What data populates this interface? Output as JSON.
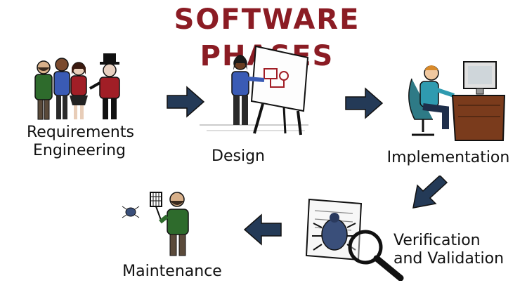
{
  "title": "SOFTWARE PHASES",
  "phases": [
    {
      "label_lines": [
        "Requirements",
        "Engineering"
      ],
      "icon": "people-group-icon"
    },
    {
      "label_lines": [
        "Design"
      ],
      "icon": "easel-designer-icon"
    },
    {
      "label_lines": [
        "Implementation"
      ],
      "icon": "programmer-at-desk-icon"
    },
    {
      "label_lines": [
        "Verification",
        "and Validation"
      ],
      "icon": "magnifier-bug-document-icon"
    },
    {
      "label_lines": [
        "Maintenance"
      ],
      "icon": "bug-swatter-person-icon"
    }
  ],
  "arrows": [
    "arrow-right-icon",
    "arrow-right-icon",
    "arrow-down-left-icon",
    "arrow-left-icon"
  ],
  "colors": {
    "title": "#8b1c24",
    "arrow": "#243a57",
    "ink": "#111111",
    "green_shirt": "#2e6b2c",
    "blue_shirt": "#3a5bb5",
    "red_shirt": "#a11e26",
    "teal_shirt": "#2f9bb0",
    "desk": "#7a3b1c"
  }
}
